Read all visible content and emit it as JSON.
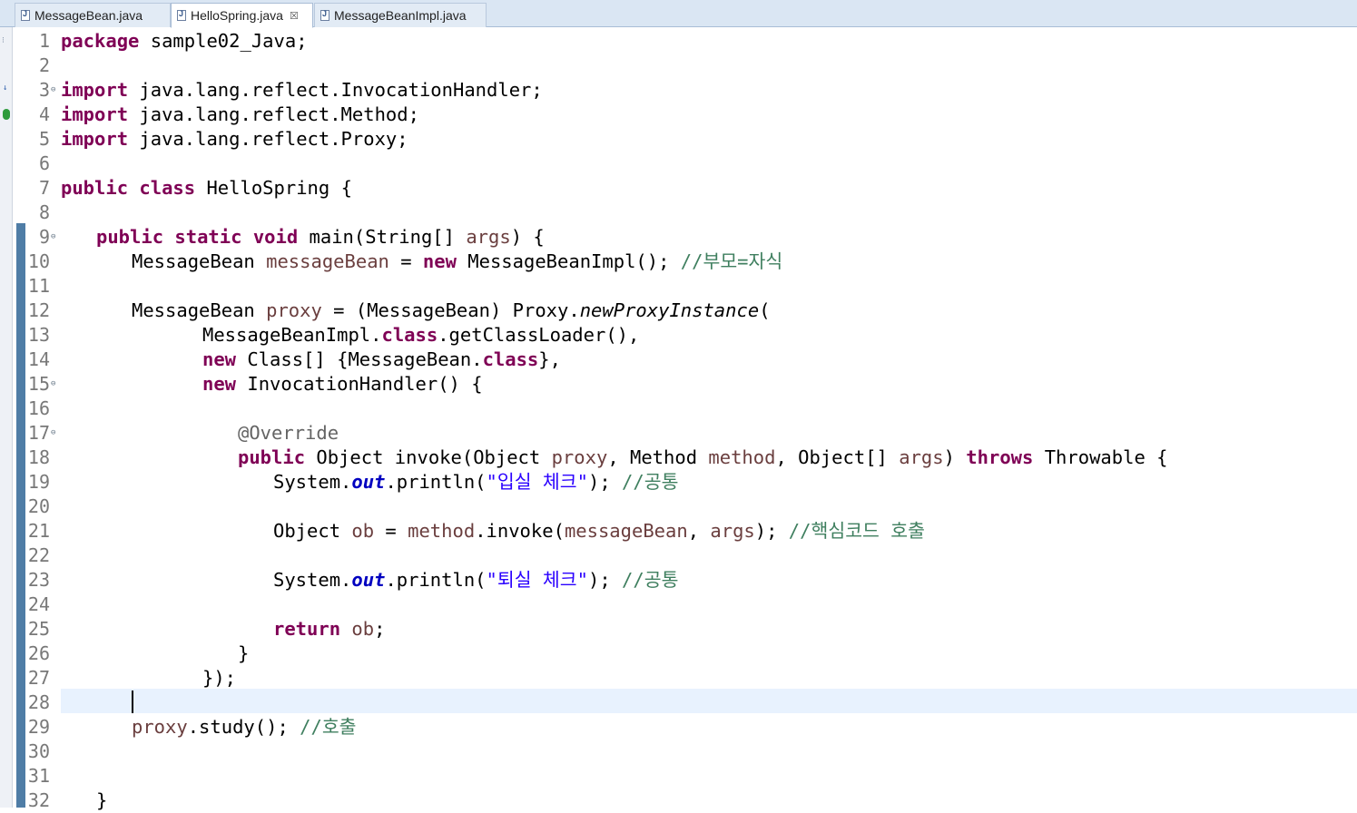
{
  "tabs": [
    {
      "label": "MessageBean.java",
      "active": false
    },
    {
      "label": "HelloSpring.java",
      "active": true,
      "close": "☒"
    },
    {
      "label": "MessageBeanImpl.java",
      "active": false
    }
  ],
  "editor": {
    "current_line": 28,
    "line_numbers": [
      "1",
      "2",
      "3",
      "4",
      "5",
      "6",
      "7",
      "8",
      "9",
      "10",
      "11",
      "12",
      "13",
      "14",
      "15",
      "16",
      "17",
      "18",
      "19",
      "20",
      "21",
      "22",
      "23",
      "24",
      "25",
      "26",
      "27",
      "28",
      "29",
      "30",
      "31",
      "32"
    ],
    "fold_markers": {
      "3": "⊖",
      "9": "⊖",
      "15": "⊖",
      "17": "⊖"
    },
    "code": {
      "l1_kw": "package",
      "l1_rest": " sample02_Java;",
      "l3_kw": "import",
      "l3_rest": " java.lang.reflect.InvocationHandler;",
      "l4_kw": "import",
      "l4_rest": " java.lang.reflect.Method;",
      "l5_kw": "import",
      "l5_rest": " java.lang.reflect.Proxy;",
      "l7_kw1": "public",
      "l7_kw2": "class",
      "l7_rest": " HelloSpring {",
      "l9_kw1": "public",
      "l9_kw2": "static",
      "l9_kw3": "void",
      "l9_a": " main(String[] ",
      "l9_var": "args",
      "l9_b": ") {",
      "l10_a": "MessageBean ",
      "l10_var": "messageBean",
      "l10_b": " = ",
      "l10_kw": "new",
      "l10_c": " MessageBeanImpl(); ",
      "l10_cmt": "//부모=자식",
      "l12_a": "MessageBean ",
      "l12_var": "proxy",
      "l12_b": " = (MessageBean) Proxy.",
      "l12_ital": "newProxyInstance",
      "l12_c": "(",
      "l13_a": "MessageBeanImpl.",
      "l13_kw": "class",
      "l13_b": ".getClassLoader(),",
      "l14_kw": "new",
      "l14_a": " Class[] {MessageBean.",
      "l14_kw2": "class",
      "l14_b": "},",
      "l15_kw": "new",
      "l15_a": " InvocationHandler() {",
      "l17_ann": "@Override",
      "l18_kw": "public",
      "l18_a": " Object invoke(Object ",
      "l18_v1": "proxy",
      "l18_b": ", Method ",
      "l18_v2": "method",
      "l18_c": ", Object[] ",
      "l18_v3": "args",
      "l18_d": ") ",
      "l18_kw2": "throws",
      "l18_e": " Throwable {",
      "l19_a": "System.",
      "l19_fld": "out",
      "l19_b": ".println(",
      "l19_str": "\"입실 체크\"",
      "l19_c": "); ",
      "l19_cmt": "//공통",
      "l21_a": "Object ",
      "l21_v1": "ob",
      "l21_b": " = ",
      "l21_v2": "method",
      "l21_c": ".invoke(",
      "l21_v3": "messageBean",
      "l21_d": ", ",
      "l21_v4": "args",
      "l21_e": "); ",
      "l21_cmt": "//핵심코드 호출",
      "l23_a": "System.",
      "l23_fld": "out",
      "l23_b": ".println(",
      "l23_str": "\"퇴실 체크\"",
      "l23_c": "); ",
      "l23_cmt": "//공통",
      "l25_kw": "return",
      "l25_sp": " ",
      "l25_var": "ob",
      "l25_b": ";",
      "l26": "}",
      "l27": "});",
      "l29_var": "proxy",
      "l29_a": ".study(); ",
      "l29_cmt": "//호출",
      "l32": "}"
    }
  }
}
